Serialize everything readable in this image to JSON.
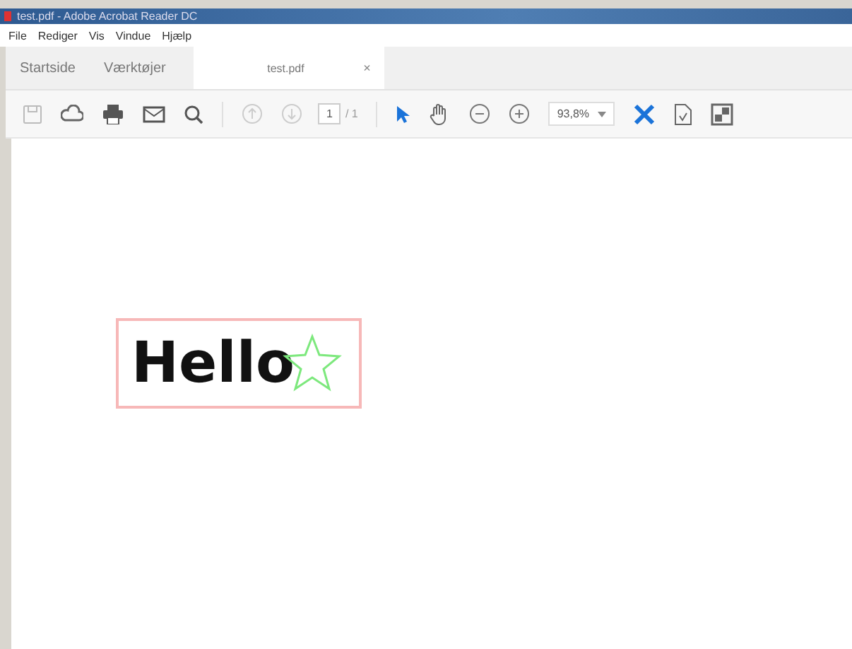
{
  "window": {
    "title": "test.pdf - Adobe Acrobat Reader DC"
  },
  "menu": [
    "File",
    "Rediger",
    "Vis",
    "Vindue",
    "Hjælp"
  ],
  "tabs": [
    {
      "label": "Startside",
      "selected": false
    },
    {
      "label": "Værktøjer",
      "selected": false
    },
    {
      "label": "test.pdf",
      "selected": true,
      "close": "×"
    }
  ],
  "toolbar": {
    "page": "1",
    "page_count": "/ 1",
    "zoom": "93,8%"
  },
  "document": {
    "text": "Hello"
  }
}
